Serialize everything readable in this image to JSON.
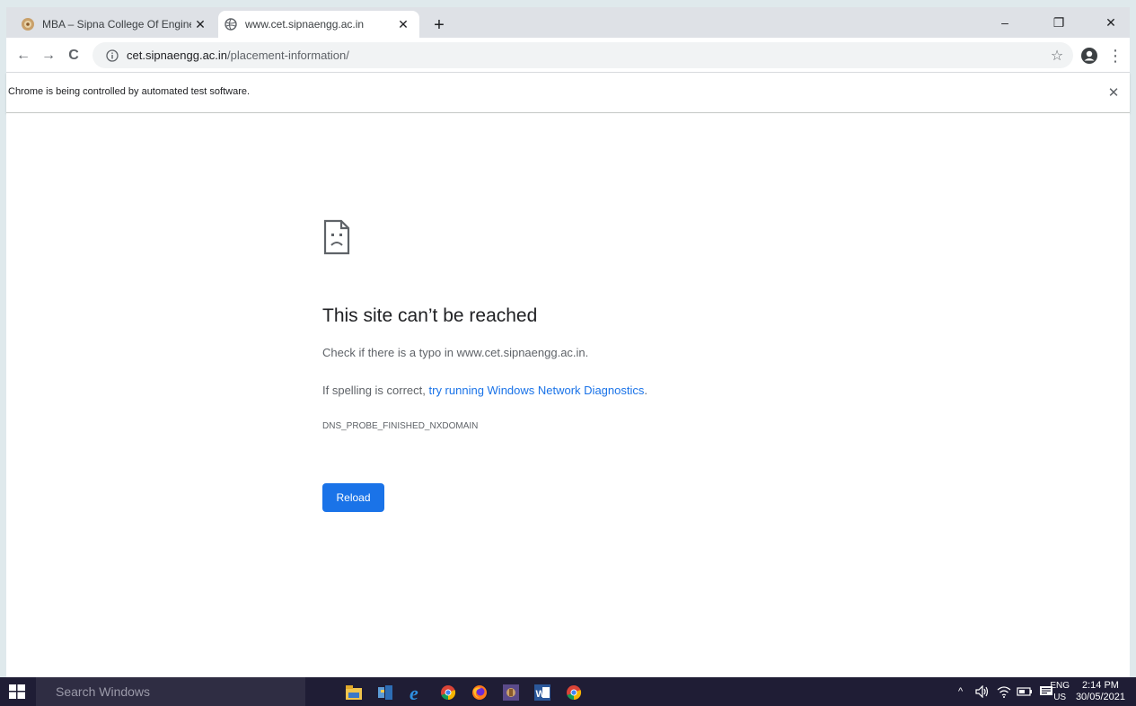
{
  "tabs": [
    {
      "title": "MBA – Sipna College Of Engineer",
      "active": false
    },
    {
      "title": "www.cet.sipnaengg.ac.in",
      "active": true
    }
  ],
  "new_tab": "+",
  "window_controls": {
    "minimize": "–",
    "restore": "❐",
    "close": "✕"
  },
  "toolbar": {
    "back": "←",
    "forward": "→",
    "reload": "C",
    "url_host": "cet.sipnaengg.ac.in",
    "url_path": "/placement-information/",
    "star": "☆",
    "menu": "⋮"
  },
  "infobar": {
    "message": "Chrome is being controlled by automated test software.",
    "close": "✕"
  },
  "error": {
    "title": "This site can’t be reached",
    "line1": "Check if there is a typo in www.cet.sipnaengg.ac.in.",
    "line2_prefix": "If spelling is correct, ",
    "line2_link": "try running Windows Network Diagnostics",
    "line2_suffix": ".",
    "code": "DNS_PROBE_FINISHED_NXDOMAIN",
    "reload_label": "Reload"
  },
  "taskbar": {
    "search_placeholder": "Search Windows",
    "lang_top": "ENG",
    "lang_bottom": "US",
    "time": "2:14 PM",
    "date": "30/05/2021"
  },
  "colors": {
    "accent": "#1a73e8",
    "taskbar": "#1f1d35"
  }
}
